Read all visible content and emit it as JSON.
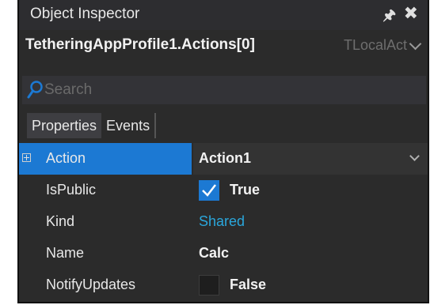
{
  "window": {
    "title": "Object Inspector",
    "pin_icon": "pin-icon",
    "close_icon": "close-icon"
  },
  "object_selector": {
    "name": "TetheringAppProfile1.Actions[0]",
    "type": "TLocalAct"
  },
  "search": {
    "placeholder": "Search",
    "value": ""
  },
  "tabs": [
    {
      "label": "Properties",
      "active": true
    },
    {
      "label": "Events",
      "active": false
    }
  ],
  "colors": {
    "selection": "#1c79d3",
    "link": "#2aa7dc",
    "panel_bg": "#2b2b2b"
  },
  "properties": [
    {
      "name": "Action",
      "value": "Action1",
      "expandable": true,
      "selected": true,
      "editor": "dropdown"
    },
    {
      "name": "IsPublic",
      "value": "True",
      "editor": "checkbox",
      "checked": true
    },
    {
      "name": "Kind",
      "value": "Shared",
      "editor": "link"
    },
    {
      "name": "Name",
      "value": "Calc",
      "editor": "text"
    },
    {
      "name": "NotifyUpdates",
      "value": "False",
      "editor": "checkbox",
      "checked": false
    }
  ]
}
